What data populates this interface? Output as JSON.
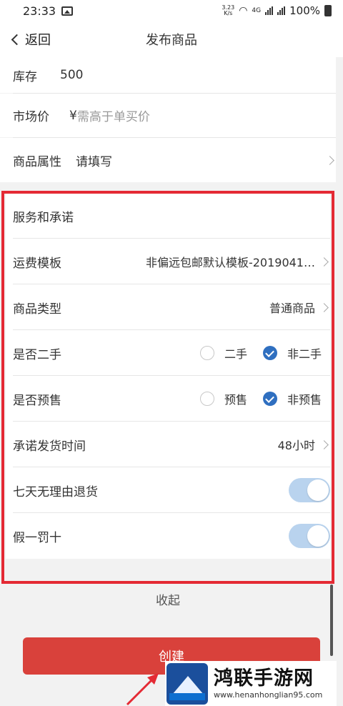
{
  "status_bar": {
    "time": "23:33",
    "net_speed_top": "3.23",
    "net_speed_unit": "K/s",
    "net_type": "4G",
    "battery": "100%"
  },
  "nav": {
    "back_label": "返回",
    "title": "发布商品"
  },
  "form": {
    "stock": {
      "label": "库存",
      "value": "500"
    },
    "market_price": {
      "label": "市场价",
      "currency": "¥",
      "placeholder": "需高于单买价"
    },
    "attributes": {
      "label": "商品属性",
      "value": "请填写"
    }
  },
  "service": {
    "title": "服务和承诺",
    "shipping_template": {
      "label": "运费模板",
      "value": "非偏远包邮默认模板-2019041…"
    },
    "goods_type": {
      "label": "商品类型",
      "value": "普通商品"
    },
    "second_hand": {
      "label": "是否二手",
      "options": [
        "二手",
        "非二手"
      ],
      "selected": "非二手"
    },
    "presale": {
      "label": "是否预售",
      "options": [
        "预售",
        "非预售"
      ],
      "selected": "非预售"
    },
    "ship_time": {
      "label": "承诺发货时间",
      "value": "48小时"
    },
    "seven_day_return": {
      "label": "七天无理由退货",
      "enabled": true
    },
    "fake_penalty": {
      "label": "假一罚十",
      "enabled": true
    }
  },
  "collapse_label": "收起",
  "create_button": "创建",
  "watermark": {
    "brand": "鸿联手游网",
    "url": "www.henanhonglian95.com"
  },
  "colors": {
    "accent_red": "#d9413b",
    "highlight_box": "#e42a34",
    "radio_blue": "#2f6fc0",
    "toggle_on": "#b9d3ee"
  }
}
